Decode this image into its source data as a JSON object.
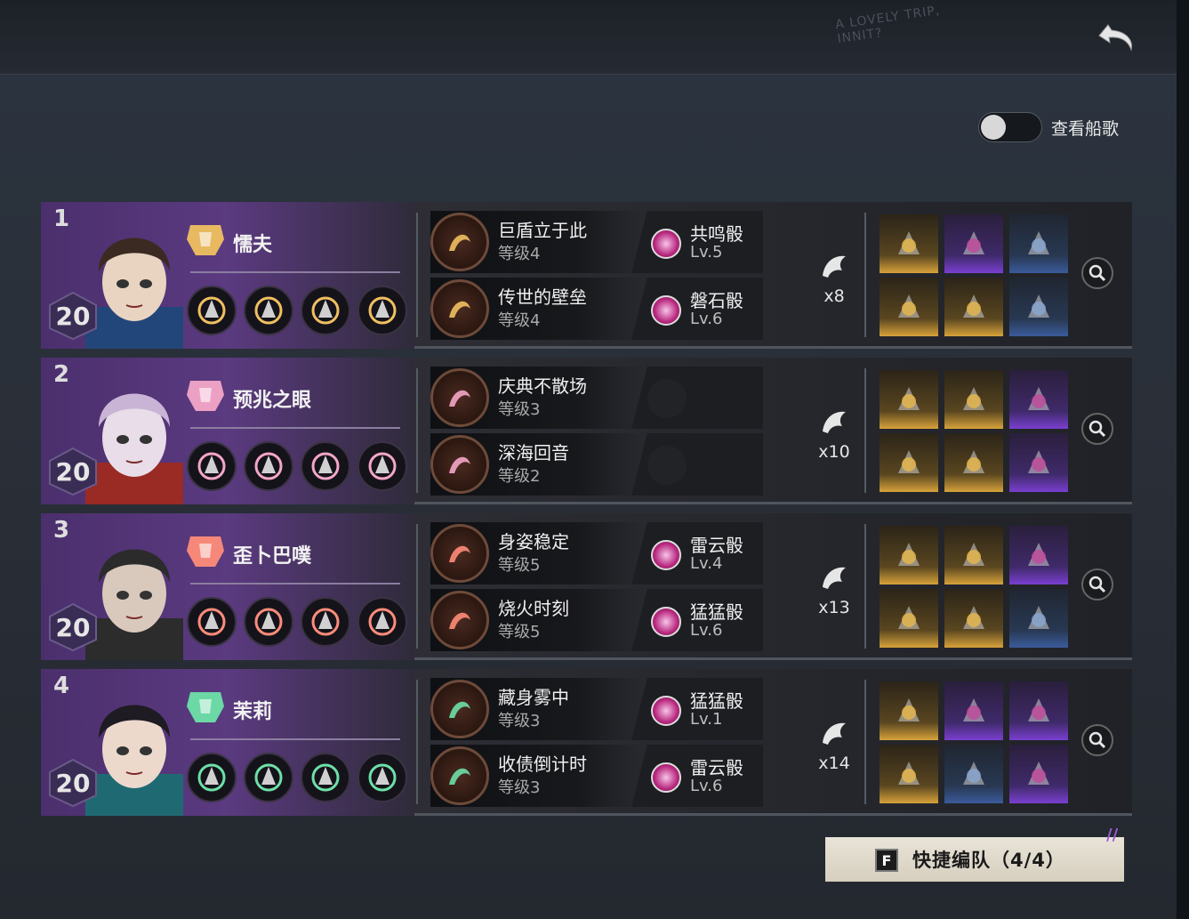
{
  "topbar": {
    "graffiti_line1": "A LOVELY TRIP,",
    "graffiti_line2": "INNIT?",
    "back_icon": "return-arrow-icon"
  },
  "toggle": {
    "label": "查看船歌",
    "checked": false
  },
  "teams": [
    {
      "number": "1",
      "level": "20",
      "name": "懦夫",
      "role_icon": "armor-icon",
      "role_color": "#f0c060",
      "skill_icons": [
        "clock-skill-icon",
        "banner-skill-icon",
        "figure-skill-icon",
        "burst-skill-icon"
      ],
      "talents": [
        {
          "name": "巨盾立于此",
          "level": "等级4",
          "icon": "shield-talent-icon"
        },
        {
          "name": "传世的壁垒",
          "level": "等级4",
          "icon": "wall-talent-icon"
        }
      ],
      "dice": [
        {
          "name": "共鸣骰",
          "level": "Lv.5"
        },
        {
          "name": "磐石骰",
          "level": "Lv.6"
        }
      ],
      "shell_count": "x8",
      "items": [
        "gold",
        "purple",
        "blue",
        "gold",
        "gold",
        "blue"
      ]
    },
    {
      "number": "2",
      "level": "20",
      "name": "预兆之眼",
      "role_icon": "lips-icon",
      "role_color": "#f4a6c8",
      "skill_icons": [
        "dancer-skill-icon",
        "swirl-skill-icon",
        "figure-skill-icon",
        "splash-skill-icon"
      ],
      "talents": [
        {
          "name": "庆典不散场",
          "level": "等级3",
          "icon": "ribbon-talent-icon"
        },
        {
          "name": "深海回音",
          "level": "等级2",
          "icon": "wave-talent-icon"
        }
      ],
      "dice": [
        {
          "name": "",
          "level": ""
        },
        {
          "name": "",
          "level": ""
        }
      ],
      "shell_count": "x10",
      "items": [
        "gold",
        "gold",
        "purple",
        "gold",
        "gold",
        "purple"
      ]
    },
    {
      "number": "3",
      "level": "20",
      "name": "歪卜巴噗",
      "role_icon": "fist-icon",
      "role_color": "#ff8c7a",
      "skill_icons": [
        "cross-skill-icon",
        "runner-skill-icon",
        "blast-skill-icon",
        "slash-skill-icon"
      ],
      "talents": [
        {
          "name": "身姿稳定",
          "level": "等级5",
          "icon": "stance-talent-icon"
        },
        {
          "name": "烧火时刻",
          "level": "等级5",
          "icon": "fire-talent-icon"
        }
      ],
      "dice": [
        {
          "name": "雷云骰",
          "level": "Lv.4"
        },
        {
          "name": "猛猛骰",
          "level": "Lv.6"
        }
      ],
      "shell_count": "x13",
      "items": [
        "gold",
        "gold",
        "purple",
        "gold",
        "gold",
        "blue"
      ]
    },
    {
      "number": "4",
      "level": "20",
      "name": "茉莉",
      "role_icon": "boot-icon",
      "role_color": "#6de0a8",
      "skill_icons": [
        "cross-skill-icon",
        "leaf-skill-icon",
        "runner-skill-icon",
        "dash-skill-icon"
      ],
      "talents": [
        {
          "name": "藏身雾中",
          "level": "等级3",
          "icon": "mist-talent-icon"
        },
        {
          "name": "收债倒计时",
          "level": "等级3",
          "icon": "flame-talent-icon"
        }
      ],
      "dice": [
        {
          "name": "猛猛骰",
          "level": "Lv.1"
        },
        {
          "name": "雷云骰",
          "level": "Lv.6"
        }
      ],
      "shell_count": "x14",
      "items": [
        "gold",
        "purple",
        "purple",
        "gold",
        "blue",
        "purple"
      ]
    }
  ],
  "quick_button": {
    "key": "F",
    "label": "快捷编队（4/4）"
  },
  "colors": {
    "accent_purple": "#5b3a80",
    "gold_item": "#d7a23a",
    "purple_item": "#7a3fd0",
    "blue_item": "#3a5b9b",
    "dice_pink": "#b9287f"
  }
}
